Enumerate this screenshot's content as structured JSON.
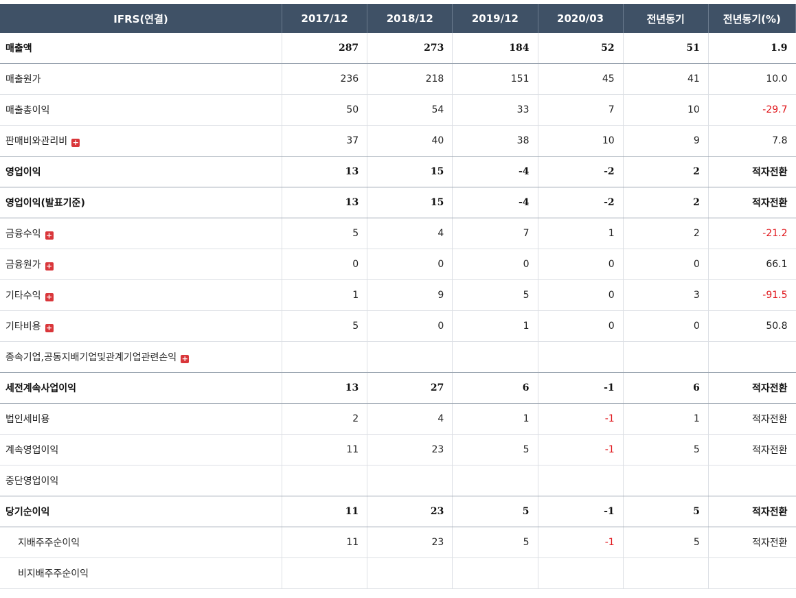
{
  "header": [
    "IFRS(연결)",
    "2017/12",
    "2018/12",
    "2019/12",
    "2020/03",
    "전년동기",
    "전년동기(%)"
  ],
  "colors": {
    "header_bg": "#3f5166",
    "negative": "#e0161b",
    "expand_icon": "#d9363a"
  },
  "rows": [
    {
      "label": "매출액",
      "bold": true,
      "values": [
        "287",
        "273",
        "184",
        "52",
        "51",
        "1.9"
      ],
      "neg": [
        false,
        false,
        false,
        false,
        false,
        false
      ]
    },
    {
      "label": "매출원가",
      "values": [
        "236",
        "218",
        "151",
        "45",
        "41",
        "10.0"
      ],
      "neg": [
        false,
        false,
        false,
        false,
        false,
        false
      ]
    },
    {
      "label": "매출총이익",
      "values": [
        "50",
        "54",
        "33",
        "7",
        "10",
        "-29.7"
      ],
      "neg": [
        false,
        false,
        false,
        false,
        false,
        true
      ]
    },
    {
      "label": "판매비와관리비",
      "expand": true,
      "values": [
        "37",
        "40",
        "38",
        "10",
        "9",
        "7.8"
      ],
      "neg": [
        false,
        false,
        false,
        false,
        false,
        false
      ]
    },
    {
      "label": "영업이익",
      "bold": true,
      "values": [
        "13",
        "15",
        "-4",
        "-2",
        "2",
        "적자전환"
      ],
      "neg": [
        false,
        false,
        true,
        true,
        false,
        false
      ]
    },
    {
      "label": "영업이익(발표기준)",
      "bold": true,
      "values": [
        "13",
        "15",
        "-4",
        "-2",
        "2",
        "적자전환"
      ],
      "neg": [
        false,
        false,
        true,
        true,
        false,
        false
      ]
    },
    {
      "label": "금융수익",
      "expand": true,
      "values": [
        "5",
        "4",
        "7",
        "1",
        "2",
        "-21.2"
      ],
      "neg": [
        false,
        false,
        false,
        false,
        false,
        true
      ]
    },
    {
      "label": "금융원가",
      "expand": true,
      "values": [
        "0",
        "0",
        "0",
        "0",
        "0",
        "66.1"
      ],
      "neg": [
        false,
        false,
        false,
        false,
        false,
        false
      ]
    },
    {
      "label": "기타수익",
      "expand": true,
      "values": [
        "1",
        "9",
        "5",
        "0",
        "3",
        "-91.5"
      ],
      "neg": [
        false,
        false,
        false,
        false,
        false,
        true
      ]
    },
    {
      "label": "기타비용",
      "expand": true,
      "values": [
        "5",
        "0",
        "1",
        "0",
        "0",
        "50.8"
      ],
      "neg": [
        false,
        false,
        false,
        false,
        false,
        false
      ]
    },
    {
      "label": "종속기업,공동지배기업및관계기업관련손익",
      "expand": true,
      "values": [
        "",
        "",
        "",
        "",
        "",
        ""
      ],
      "neg": [
        false,
        false,
        false,
        false,
        false,
        false
      ]
    },
    {
      "label": "세전계속사업이익",
      "bold": true,
      "values": [
        "13",
        "27",
        "6",
        "-1",
        "6",
        "적자전환"
      ],
      "neg": [
        false,
        false,
        false,
        true,
        false,
        false
      ]
    },
    {
      "label": "법인세비용",
      "values": [
        "2",
        "4",
        "1",
        "-1",
        "1",
        "적자전환"
      ],
      "neg": [
        false,
        false,
        false,
        true,
        false,
        false
      ]
    },
    {
      "label": "계속영업이익",
      "values": [
        "11",
        "23",
        "5",
        "-1",
        "5",
        "적자전환"
      ],
      "neg": [
        false,
        false,
        false,
        true,
        false,
        false
      ]
    },
    {
      "label": "중단영업이익",
      "values": [
        "",
        "",
        "",
        "",
        "",
        ""
      ],
      "neg": [
        false,
        false,
        false,
        false,
        false,
        false
      ]
    },
    {
      "label": "당기순이익",
      "bold": true,
      "values": [
        "11",
        "23",
        "5",
        "-1",
        "5",
        "적자전환"
      ],
      "neg": [
        false,
        false,
        false,
        true,
        false,
        false
      ]
    },
    {
      "label": "지배주주순이익",
      "indent": true,
      "values": [
        "11",
        "23",
        "5",
        "-1",
        "5",
        "적자전환"
      ],
      "neg": [
        false,
        false,
        false,
        true,
        false,
        false
      ]
    },
    {
      "label": "비지배주주순이익",
      "indent": true,
      "values": [
        "",
        "",
        "",
        "",
        "",
        ""
      ],
      "neg": [
        false,
        false,
        false,
        false,
        false,
        false
      ]
    }
  ]
}
